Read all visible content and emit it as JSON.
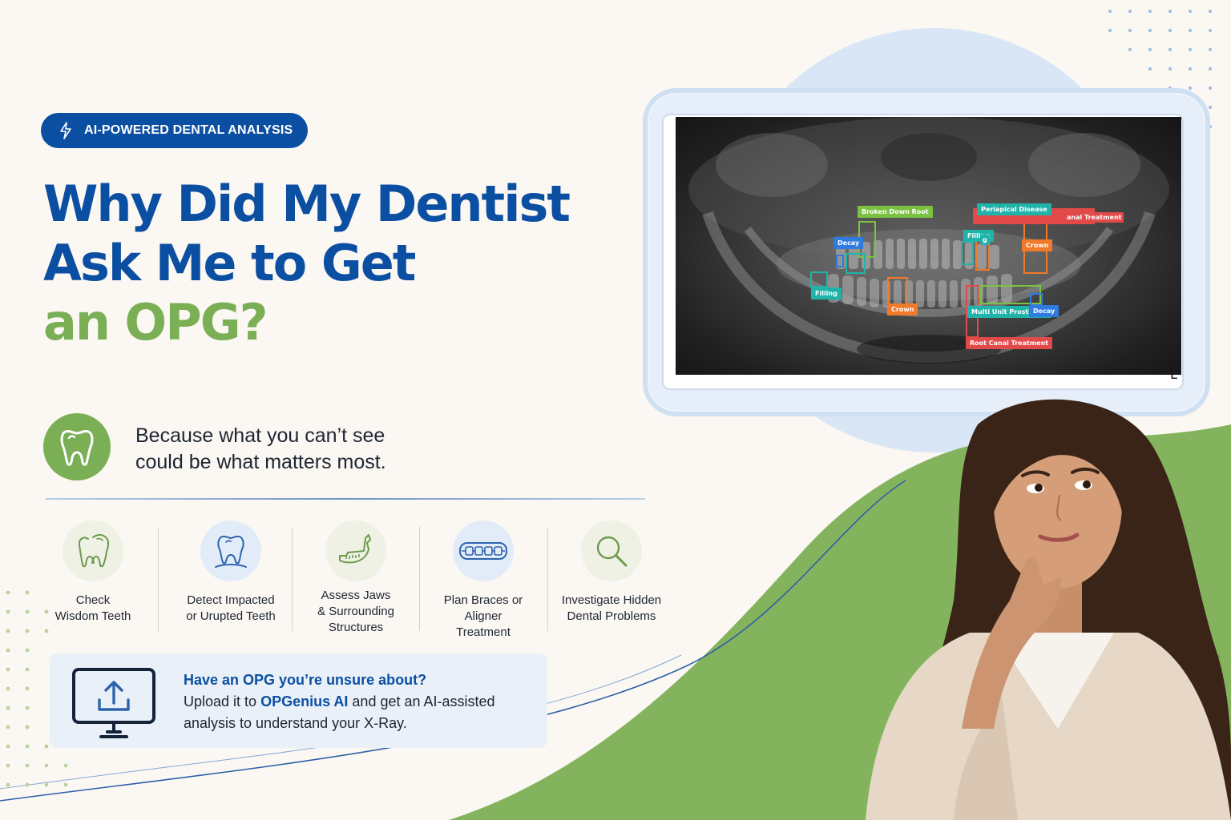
{
  "badge": {
    "text": "AI-POWERED DENTAL ANALYSIS",
    "icon": "lightning-bolt-icon"
  },
  "headline": {
    "line1": "Why Did My Dentist",
    "line2": "Ask Me to Get",
    "line3": "an OPG?"
  },
  "tagline": {
    "icon": "tooth-icon",
    "line1": "Because what you can’t see",
    "line2": "could be what matters most."
  },
  "features": [
    {
      "icon": "wisdom-teeth-icon",
      "line1": "Check",
      "line2": "Wisdom Teeth",
      "line3": ""
    },
    {
      "icon": "impacted-tooth-icon",
      "line1": "Detect Impacted",
      "line2": "or Urupted Teeth",
      "line3": ""
    },
    {
      "icon": "jaw-icon",
      "line1": "Assess Jaws",
      "line2": "& Surrounding",
      "line3": "Structures"
    },
    {
      "icon": "braces-icon",
      "line1": "Plan Braces or",
      "line2": "Aligner",
      "line3": "Treatment"
    },
    {
      "icon": "magnifier-icon",
      "line1": "Investigate Hidden",
      "line2": "Dental Problems",
      "line3": ""
    }
  ],
  "upload": {
    "icon": "monitor-upload-icon",
    "question": "Have an OPG you’re unsure about?",
    "text_prefix": "Upload it to ",
    "brand": "OPGenius AI",
    "text_suffix": " and get an AI-assisted",
    "line3": "analysis to understand your X-Ray."
  },
  "xray": {
    "corner_mark": "L",
    "labels": {
      "broken_down_root": "Broken Down Root",
      "periapical_disease": "Periapical Disease",
      "canal_treatment_partial": "anal Treatment",
      "decay_1": "Decay",
      "filling_1": "Filling",
      "filling_partial": "g",
      "crown_1": "Crown",
      "filling_2": "Filling",
      "crown_2": "Crown",
      "multi_unit": "Multi Unit Prosthesis",
      "decay_2": "Decay",
      "root_canal": "Root Canal Treatment"
    },
    "colors": {
      "green": "#7cc242",
      "teal": "#1fb3aa",
      "blue": "#2f7be0",
      "orange": "#f07a2a",
      "red": "#e24a4a"
    }
  },
  "colors": {
    "brand_blue": "#0b4fa3",
    "brand_green": "#7aaf55",
    "background": "#fbf7f2"
  }
}
